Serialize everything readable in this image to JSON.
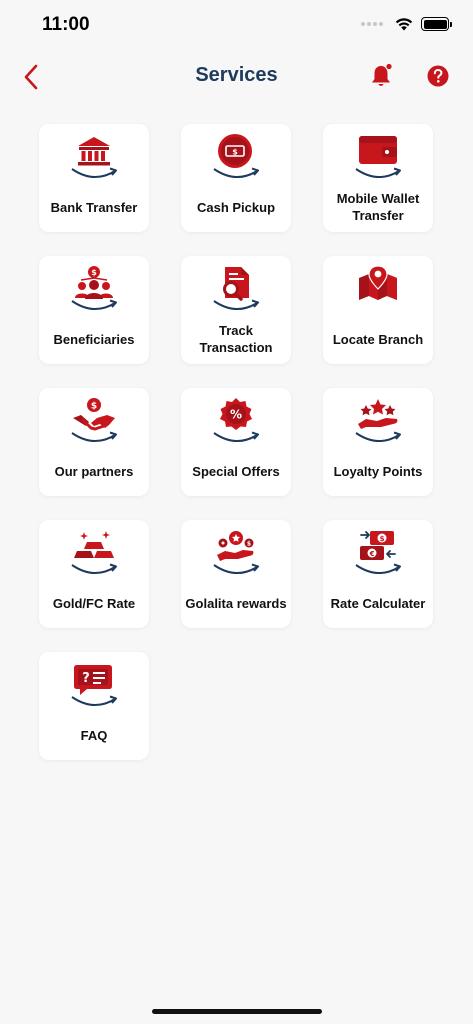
{
  "status": {
    "time": "11:00"
  },
  "header": {
    "title": "Services"
  },
  "colors": {
    "brand_red": "#c8161d",
    "navy": "#1e3a5c"
  },
  "services": [
    {
      "label": "Bank Transfer",
      "icon": "bank-icon"
    },
    {
      "label": "Cash Pickup",
      "icon": "cash-icon"
    },
    {
      "label": "Mobile Wallet Transfer",
      "icon": "wallet-icon"
    },
    {
      "label": "Beneficiaries",
      "icon": "people-icon"
    },
    {
      "label": "Track Transaction",
      "icon": "track-document-icon"
    },
    {
      "label": "Locate Branch",
      "icon": "map-pin-icon"
    },
    {
      "label": "Our partners",
      "icon": "handshake-icon"
    },
    {
      "label": "Special Offers",
      "icon": "discount-badge-icon"
    },
    {
      "label": "Loyalty Points",
      "icon": "stars-hand-icon"
    },
    {
      "label": "Gold/FC Rate",
      "icon": "gold-bars-icon"
    },
    {
      "label": "Golalita rewards",
      "icon": "rewards-icon"
    },
    {
      "label": "Rate Calculater",
      "icon": "currency-exchange-icon"
    },
    {
      "label": "FAQ",
      "icon": "faq-chat-icon"
    }
  ]
}
